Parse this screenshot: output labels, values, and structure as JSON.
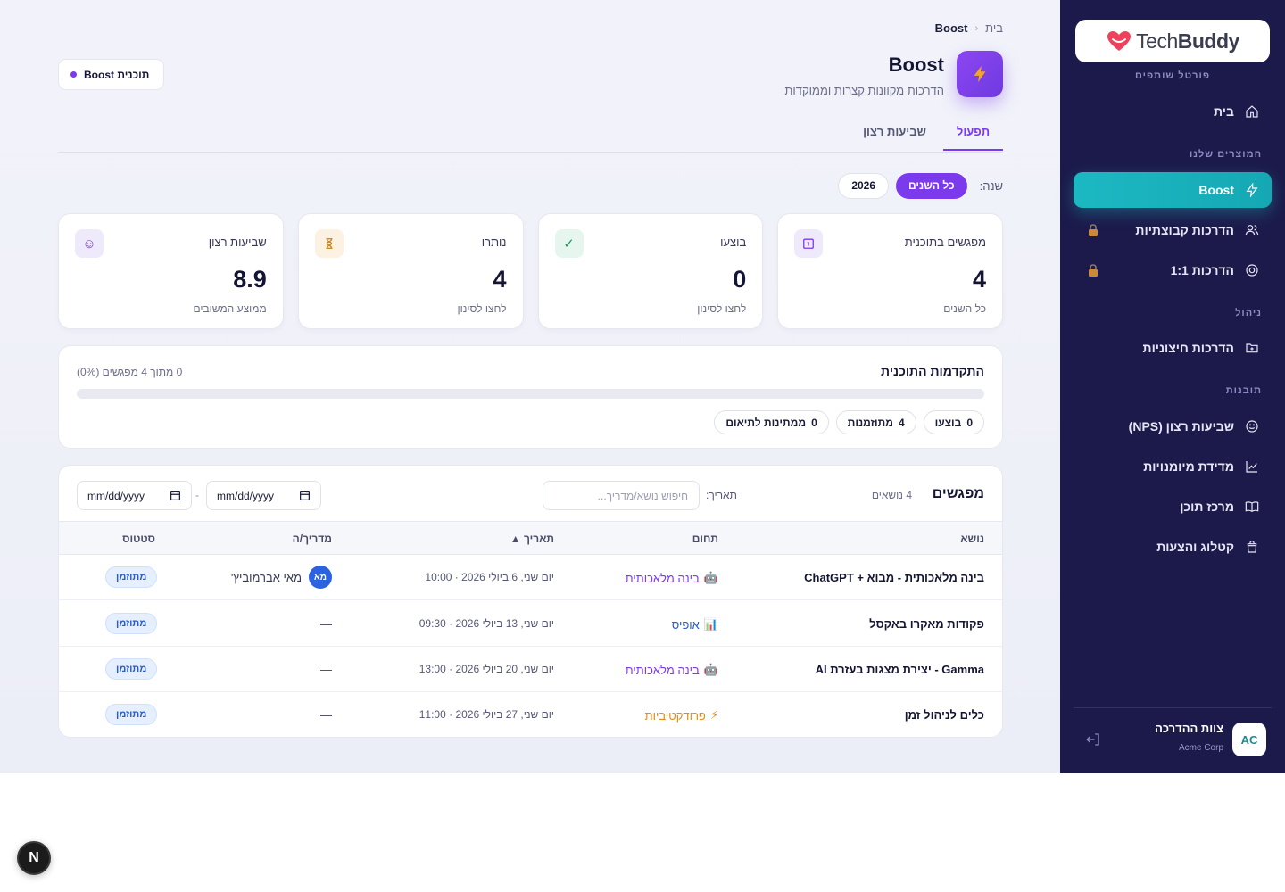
{
  "sidebar": {
    "logo_text_light": "Tech",
    "logo_text_bold": "Buddy",
    "portal_label": "פורטל שותפים",
    "home_label": "בית",
    "section_products": "המוצרים שלנו",
    "section_management": "ניהול",
    "section_insights": "תובנות",
    "items": [
      {
        "label": "Boost",
        "icon": "lightning-icon",
        "active": true
      },
      {
        "label": "הדרכות קבוצתיות",
        "icon": "users-icon",
        "locked": true
      },
      {
        "label": "הדרכות 1:1",
        "icon": "target-icon",
        "locked": true
      },
      {
        "label": "הדרכות חיצוניות",
        "icon": "folder-plus-icon"
      },
      {
        "label": "שביעות רצון (NPS)",
        "icon": "smile-icon"
      },
      {
        "label": "מדידת מיומנויות",
        "icon": "chart-icon"
      },
      {
        "label": "מרכז תוכן",
        "icon": "book-icon"
      },
      {
        "label": "קטלוג והצעות",
        "icon": "bag-icon"
      }
    ],
    "user": {
      "initials": "AC",
      "name": "צוות ההדרכה",
      "company": "Acme Corp"
    }
  },
  "breadcrumb": {
    "home": "בית",
    "separator": "‹",
    "current": "Boost"
  },
  "header": {
    "title": "Boost",
    "subtitle": "הדרכות מקוונות קצרות וממוקדות",
    "plan_chip": "תוכנית Boost"
  },
  "tabs": [
    {
      "label": "תפעול",
      "active": true
    },
    {
      "label": "שביעות רצון",
      "active": false
    }
  ],
  "year_filter": {
    "label": "שנה:",
    "options": [
      "כל השנים",
      "2026"
    ],
    "selected": "כל השנים"
  },
  "stats": [
    {
      "label": "מפגשים בתוכנית",
      "value": "4",
      "sub": "כל השנים",
      "icon": "calendar-icon",
      "icon_glyph": "1",
      "icon_bg": "#efe9fc",
      "icon_color": "#7c3aed"
    },
    {
      "label": "בוצעו",
      "value": "0",
      "sub": "לחצו לסינון",
      "icon": "check-icon",
      "icon_glyph": "✓",
      "icon_bg": "#e6f6ee",
      "icon_color": "#1b9a5a"
    },
    {
      "label": "נותרו",
      "value": "4",
      "sub": "לחצו לסינון",
      "icon": "hourglass-icon",
      "icon_glyph": "⏳",
      "icon_bg": "#fdf1e1",
      "icon_color": "#d48a1a"
    },
    {
      "label": "שביעות רצון",
      "value": "8.9",
      "sub": "ממוצע המשובים",
      "icon": "smile-icon",
      "icon_glyph": "☺",
      "icon_bg": "#efe9fc",
      "icon_color": "#7c3aed"
    }
  ],
  "progress": {
    "title": "התקדמות התוכנית",
    "meta": "0 מתוך 4 מפגשים (0%)",
    "fraction": 0,
    "chips": [
      {
        "count": "0",
        "label": "בוצעו"
      },
      {
        "count": "4",
        "label": "מתוזמנות"
      },
      {
        "count": "0",
        "label": "ממתינות לתיאום"
      }
    ]
  },
  "sessions": {
    "title": "מפגשים",
    "count": "4 נושאים",
    "search_placeholder": "חיפוש נושא/מדריך...",
    "date_label": "תאריך:",
    "date_placeholder": "mm/dd/yyyy",
    "date_separator": "-",
    "columns": {
      "topic": "נושא",
      "domain": "תחום",
      "date": "תאריך ▲",
      "coach": "מדריך/ה",
      "status": "סטטוס"
    },
    "rows": [
      {
        "topic": "בינה מלאכותית - מבוא + ChatGPT",
        "domain": "בינה מלאכותית",
        "domain_icon": "robot-icon",
        "domain_color": "#7c3aed",
        "date": "יום שני, 6 ביולי 2026 · 10:00",
        "coach": "מאי אברמוביץ'",
        "coach_initials": "מא",
        "status": "מתוזמן"
      },
      {
        "topic": "פקודות מאקרו באקסל",
        "domain": "אופיס",
        "domain_icon": "bar-chart-icon",
        "domain_color": "#2b5ccb",
        "date": "יום שני, 13 ביולי 2026 · 09:30",
        "coach": "—",
        "coach_initials": "",
        "status": "מתוזמן"
      },
      {
        "topic": "Gamma - יצירת מצגות בעזרת AI",
        "domain": "בינה מלאכותית",
        "domain_icon": "robot-icon",
        "domain_color": "#7c3aed",
        "date": "יום שני, 20 ביולי 2026 · 13:00",
        "coach": "—",
        "coach_initials": "",
        "status": "מתוזמן"
      },
      {
        "topic": "כלים לניהול זמן",
        "domain": "פרודקטיביות",
        "domain_icon": "lightning-icon",
        "domain_color": "#e68a1a",
        "date": "יום שני, 27 ביולי 2026 · 11:00",
        "coach": "—",
        "coach_initials": "",
        "status": "מתוזמן"
      }
    ]
  },
  "dev_badge": "N"
}
